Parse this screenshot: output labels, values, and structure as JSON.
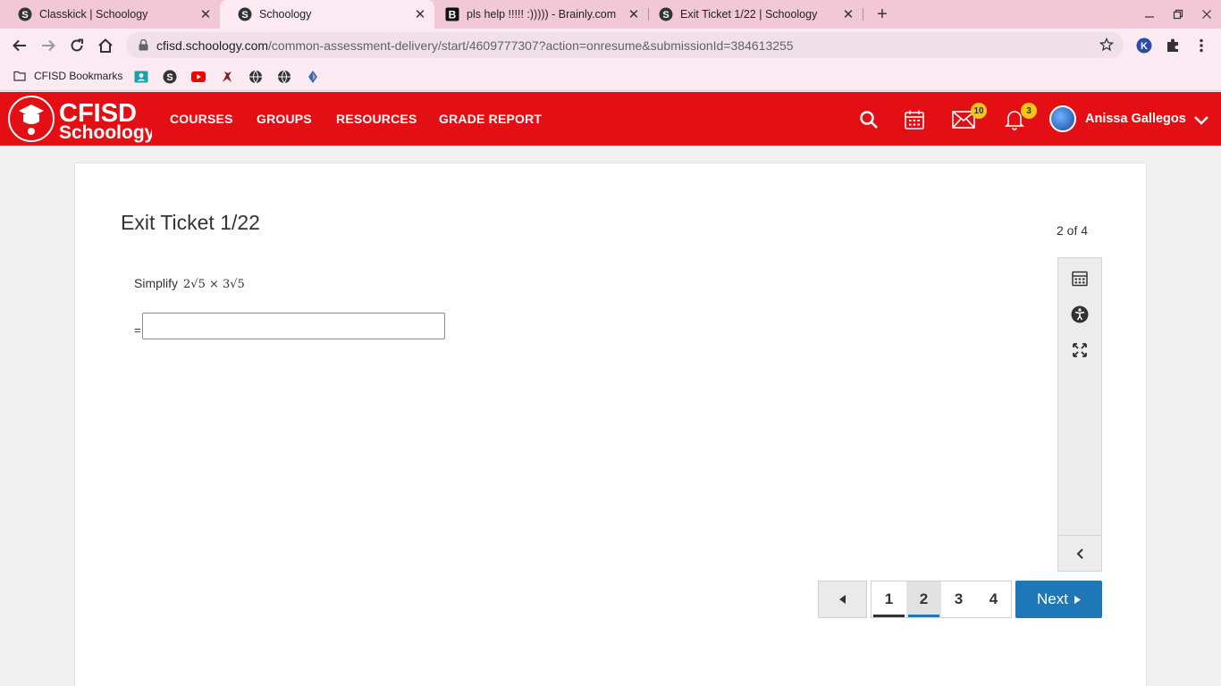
{
  "browser": {
    "tabs": [
      {
        "title": "Classkick | Schoology",
        "favicon": "schoology-icon",
        "active": false
      },
      {
        "title": "Schoology",
        "favicon": "schoology-icon",
        "active": true
      },
      {
        "title": "pls help !!!!! :))))) - Brainly.com",
        "favicon": "brainly-icon",
        "active": false
      },
      {
        "title": "Exit Ticket 1/22 | Schoology",
        "favicon": "schoology-icon",
        "active": false
      }
    ],
    "url_domain": "cfisd.schoology.com",
    "url_path": "/common-assessment-delivery/start/4609777307?action=onresume&submissionId=384613255",
    "bookmarks_folder": "CFISD Bookmarks"
  },
  "header": {
    "logo_text_top": "CFISD",
    "logo_text_bottom": "Schoology",
    "nav": [
      "COURSES",
      "GROUPS",
      "RESOURCES",
      "GRADE REPORT"
    ],
    "messages_count": "10",
    "notifications_count": "3",
    "user_name": "Anissa Gallegos",
    "accent_color": "#e30f14"
  },
  "assessment": {
    "title": "Exit Ticket 1/22",
    "progress": "2 of 4",
    "question_prefix": "Simplify",
    "question_math": "2√5 × 3√5",
    "equals": "=",
    "answer_value": ""
  },
  "pager": {
    "pages": [
      "1",
      "2",
      "3",
      "4"
    ],
    "current": "2",
    "next_label": "Next"
  }
}
